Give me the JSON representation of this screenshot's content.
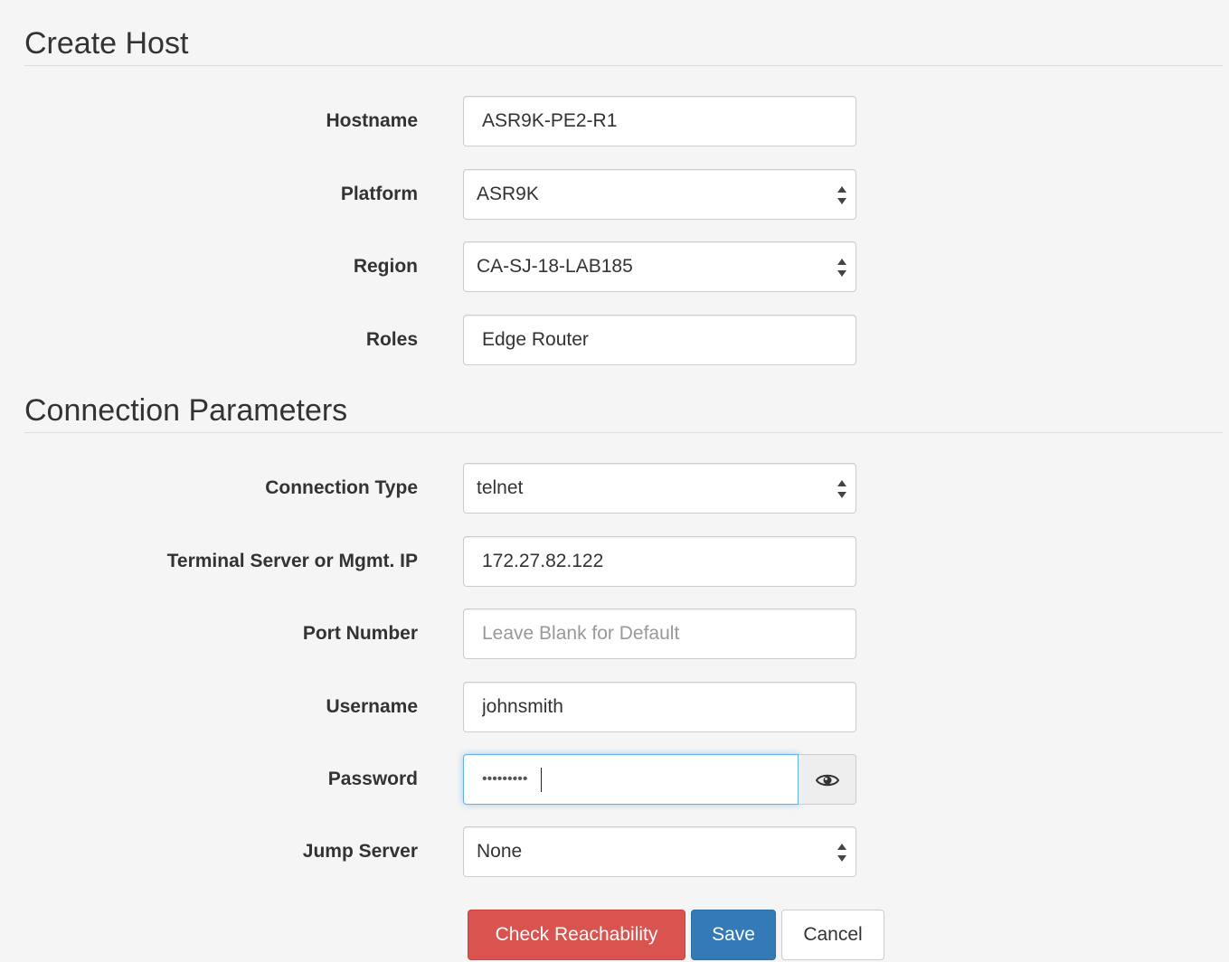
{
  "create_host": {
    "title": "Create Host",
    "hostname": {
      "label": "Hostname",
      "value": "ASR9K-PE2-R1"
    },
    "platform": {
      "label": "Platform",
      "value": "ASR9K"
    },
    "region": {
      "label": "Region",
      "value": "CA-SJ-18-LAB185"
    },
    "roles": {
      "label": "Roles",
      "value": "Edge Router"
    }
  },
  "connection": {
    "title": "Connection Parameters",
    "connection_type": {
      "label": "Connection Type",
      "value": "telnet"
    },
    "terminal_server": {
      "label": "Terminal Server or Mgmt. IP",
      "value": "172.27.82.122"
    },
    "port_number": {
      "label": "Port Number",
      "value": "",
      "placeholder": "Leave Blank for Default"
    },
    "username": {
      "label": "Username",
      "value": "johnsmith"
    },
    "password": {
      "label": "Password",
      "masked": "•••••••••"
    },
    "jump_server": {
      "label": "Jump Server",
      "value": "None"
    }
  },
  "actions": {
    "check_reachability": "Check Reachability",
    "save": "Save",
    "cancel": "Cancel"
  },
  "icons": {
    "select_arrows": "up-down-caret-icon",
    "show_password": "eye-icon"
  },
  "colors": {
    "danger": "#d9534f",
    "primary": "#337ab7",
    "focus_border": "#66afe9",
    "background": "#f5f5f5"
  }
}
